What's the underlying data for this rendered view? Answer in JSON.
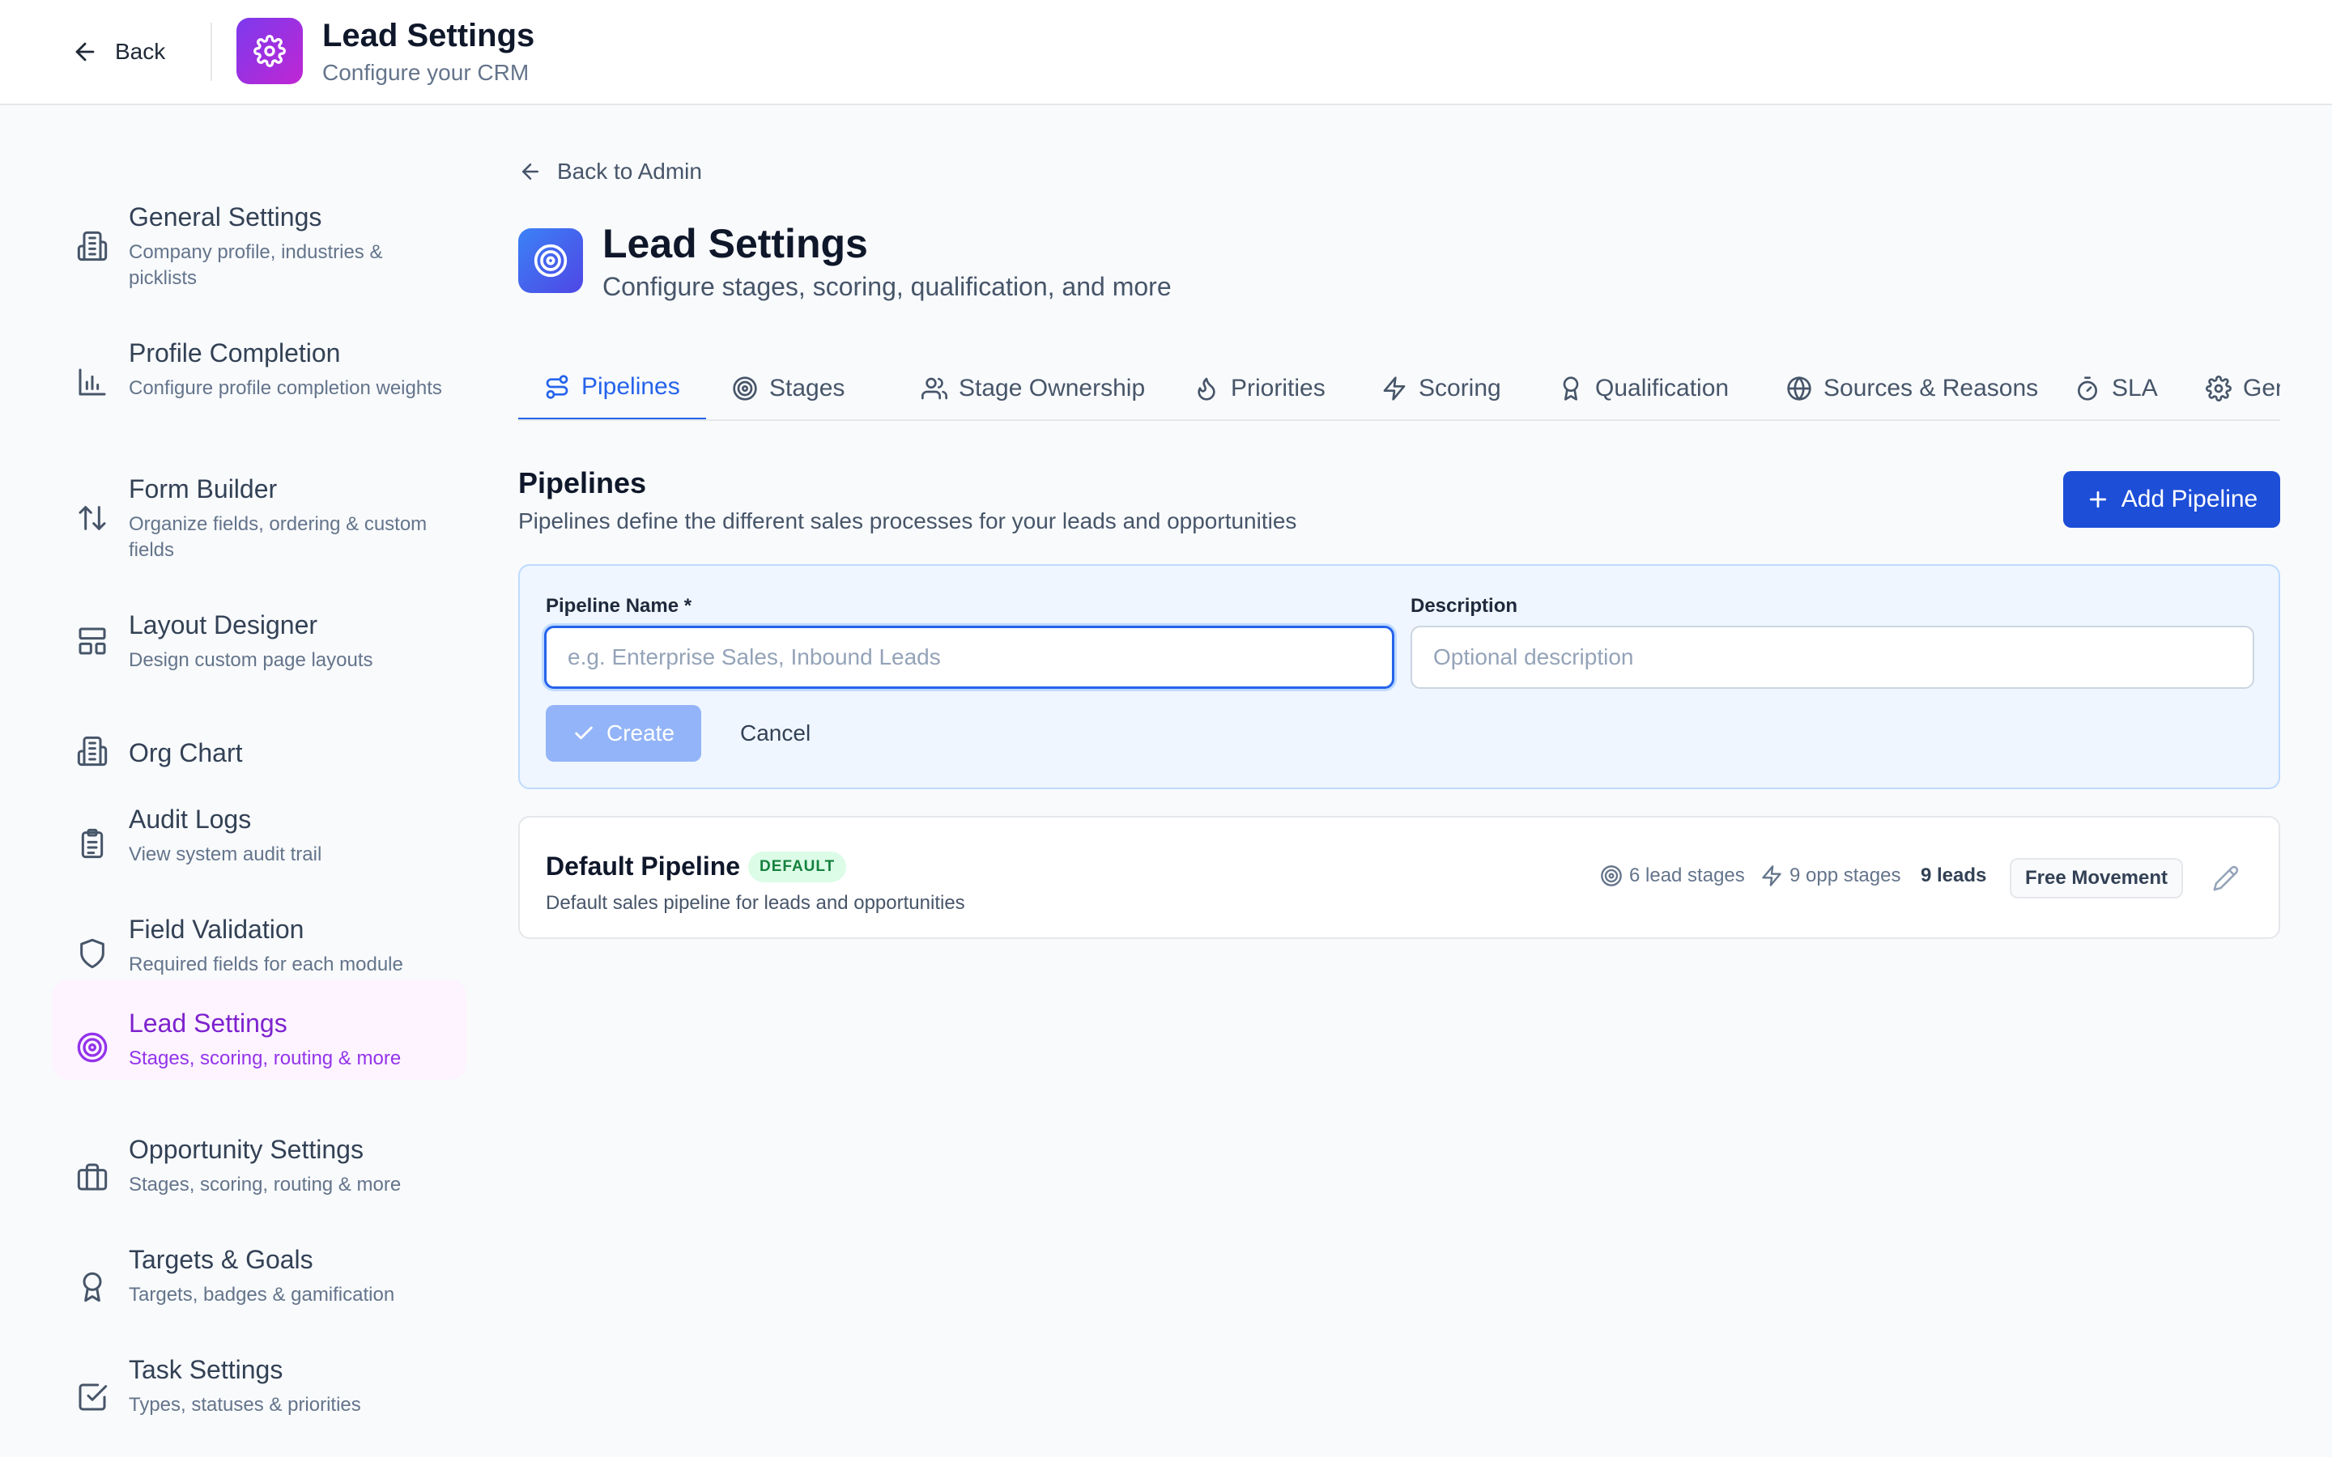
{
  "header": {
    "back_label": "Back",
    "title": "Lead Settings",
    "subtitle": "Configure your CRM"
  },
  "sidebar": {
    "items": [
      {
        "title": "General Settings",
        "desc": "Company profile, industries & picklists",
        "icon": "building-icon"
      },
      {
        "title": "Profile Completion",
        "desc": "Configure profile completion weights",
        "icon": "bar-chart-icon"
      },
      {
        "title": "Form Builder",
        "desc": "Organize fields, ordering & custom fields",
        "icon": "sort-arrows-icon"
      },
      {
        "title": "Layout Designer",
        "desc": "Design custom page layouts",
        "icon": "layout-icon"
      },
      {
        "title": "Org Chart",
        "desc": "",
        "icon": "building-icon"
      },
      {
        "title": "Audit Logs",
        "desc": "View system audit trail",
        "icon": "clipboard-icon"
      },
      {
        "title": "Field Validation",
        "desc": "Required fields for each module",
        "icon": "shield-icon"
      },
      {
        "title": "Lead Settings",
        "desc": "Stages, scoring, routing & more",
        "icon": "target-icon",
        "active": true
      },
      {
        "title": "Opportunity Settings",
        "desc": "Stages, scoring, routing & more",
        "icon": "briefcase-icon"
      },
      {
        "title": "Targets & Goals",
        "desc": "Targets, badges & gamification",
        "icon": "award-icon"
      },
      {
        "title": "Task Settings",
        "desc": "Types, statuses & priorities",
        "icon": "check-square-icon"
      }
    ]
  },
  "main": {
    "back_admin_label": "Back to Admin",
    "title": "Lead Settings",
    "subtitle": "Configure stages, scoring, qualification, and more",
    "tabs": [
      {
        "label": "Pipelines",
        "icon": "pipeline-icon",
        "active": true
      },
      {
        "label": "Stages",
        "icon": "target-icon"
      },
      {
        "label": "Stage Ownership",
        "icon": "users-icon"
      },
      {
        "label": "Priorities",
        "icon": "flame-icon"
      },
      {
        "label": "Scoring",
        "icon": "zap-icon"
      },
      {
        "label": "Qualification",
        "icon": "award-icon"
      },
      {
        "label": "Sources & Reasons",
        "icon": "globe-icon"
      },
      {
        "label": "SLA",
        "icon": "timer-icon"
      },
      {
        "label": "Gene",
        "icon": "gear-icon"
      }
    ],
    "section": {
      "title": "Pipelines",
      "description": "Pipelines define the different sales processes for your leads and opportunities",
      "add_button": "Add Pipeline"
    },
    "form": {
      "name_label": "Pipeline Name *",
      "name_placeholder": "e.g. Enterprise Sales, Inbound Leads",
      "name_value": "",
      "desc_label": "Description",
      "desc_placeholder": "Optional description",
      "desc_value": "",
      "create_label": "Create",
      "cancel_label": "Cancel"
    },
    "pipeline": {
      "name": "Default Pipeline",
      "badge": "DEFAULT",
      "description": "Default sales pipeline for leads and opportunities",
      "lead_stages": "6 lead stages",
      "opp_stages": "9 opp stages",
      "leads": "9 leads",
      "movement": "Free Movement"
    }
  },
  "colors": {
    "primary": "#1d4ed8",
    "active_tab": "#2563eb",
    "sidebar_active": "#7e22ce",
    "default_badge_bg": "#dcfce7",
    "default_badge_text": "#15803d"
  }
}
